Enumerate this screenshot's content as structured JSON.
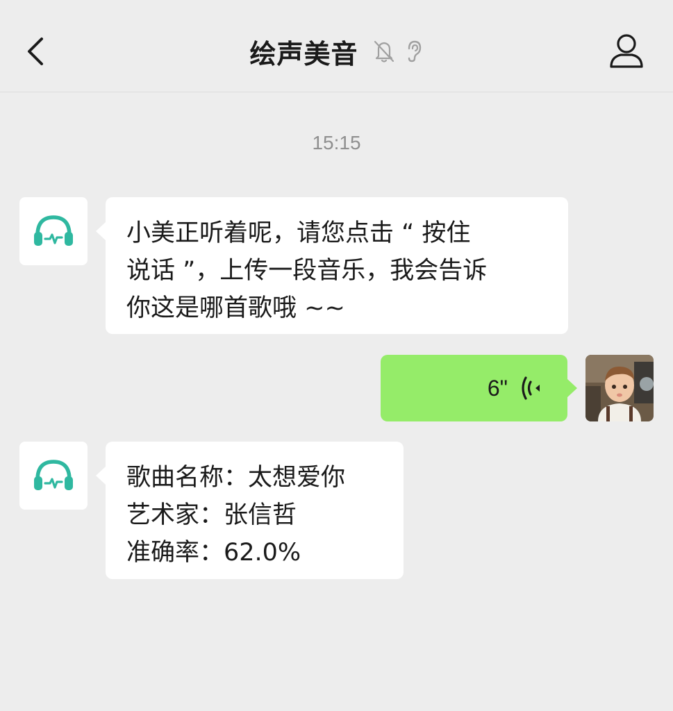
{
  "header": {
    "title": "绘声美音",
    "back_icon": "chevron-left-icon",
    "mute_icon": "bell-off-icon",
    "earpiece_icon": "ear-icon",
    "profile_icon": "person-icon"
  },
  "chat": {
    "timestamp": "15:15",
    "messages": [
      {
        "sender": "bot",
        "avatar_icon": "headphones-icon",
        "lines": [
          "小美正听着呢，请您点击 “ 按住",
          "说话 ”，上传一段音乐，我会告诉",
          "你这是哪首歌哦 ~~"
        ]
      },
      {
        "sender": "user",
        "type": "voice",
        "duration": "6\"",
        "voice_icon": "voice-wave-icon"
      },
      {
        "sender": "bot",
        "avatar_icon": "headphones-icon",
        "lines": [
          "歌曲名称：太想爱你",
          "艺术家：张信哲",
          "准确率：62.0%"
        ]
      }
    ]
  },
  "colors": {
    "background": "#ededed",
    "bubble_self": "#95ec69",
    "bubble_other": "#ffffff",
    "accent_teal": "#2fb8a0"
  }
}
